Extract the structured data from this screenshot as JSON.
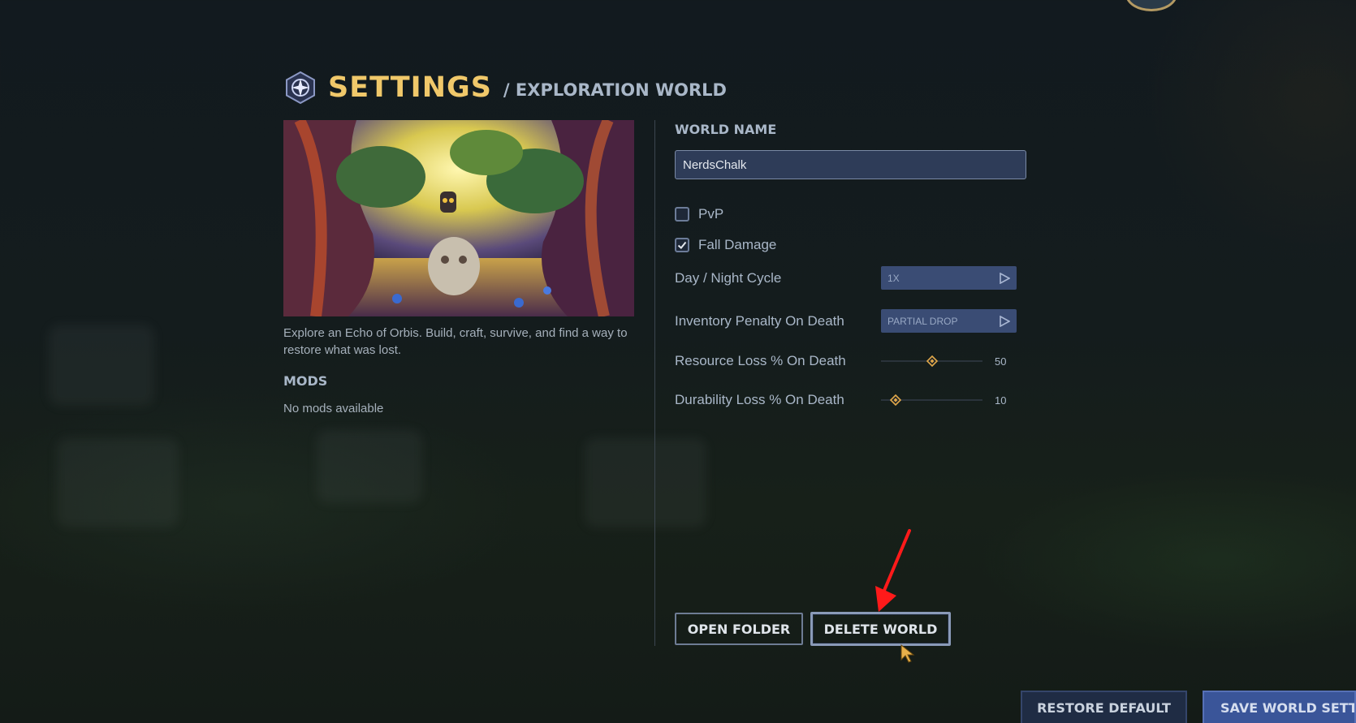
{
  "header": {
    "title": "SETTINGS",
    "subtitle": "/ EXPLORATION WORLD"
  },
  "world": {
    "description": "Explore an Echo of Orbis. Build, craft, survive, and find a way to restore what was lost.",
    "mods_title": "MODS",
    "mods_empty": "No mods available"
  },
  "settings": {
    "name_label": "WORLD NAME",
    "name_value": "NerdsChalk",
    "pvp": {
      "label": "PvP",
      "checked": false
    },
    "fall_damage": {
      "label": "Fall Damage",
      "checked": true
    },
    "day_night": {
      "label": "Day / Night Cycle",
      "value": "1X"
    },
    "inventory_penalty": {
      "label": "Inventory Penalty On Death",
      "value": "PARTIAL DROP"
    },
    "resource_loss": {
      "label": "Resource Loss % On Death",
      "value": "50",
      "fraction": 0.5
    },
    "durability_loss": {
      "label": "Durability Loss % On Death",
      "value": "10",
      "fraction": 0.1
    }
  },
  "actions": {
    "open_folder": "OPEN FOLDER",
    "delete_world": "DELETE WORLD",
    "restore_default": "RESTORE DEFAULT",
    "save_settings": "SAVE WORLD SETTINGS"
  },
  "icons": {
    "logo": "compass-emblem-icon",
    "cycle_arrow": "play-arrow-icon",
    "slider_thumb": "diamond-icon",
    "check": "checkmark-icon"
  },
  "colors": {
    "title_gold": "#f0c86a",
    "accent_blue": "#3a5599",
    "annotation_red": "#ff1a1a",
    "slider_thumb": "#e0a84a"
  }
}
